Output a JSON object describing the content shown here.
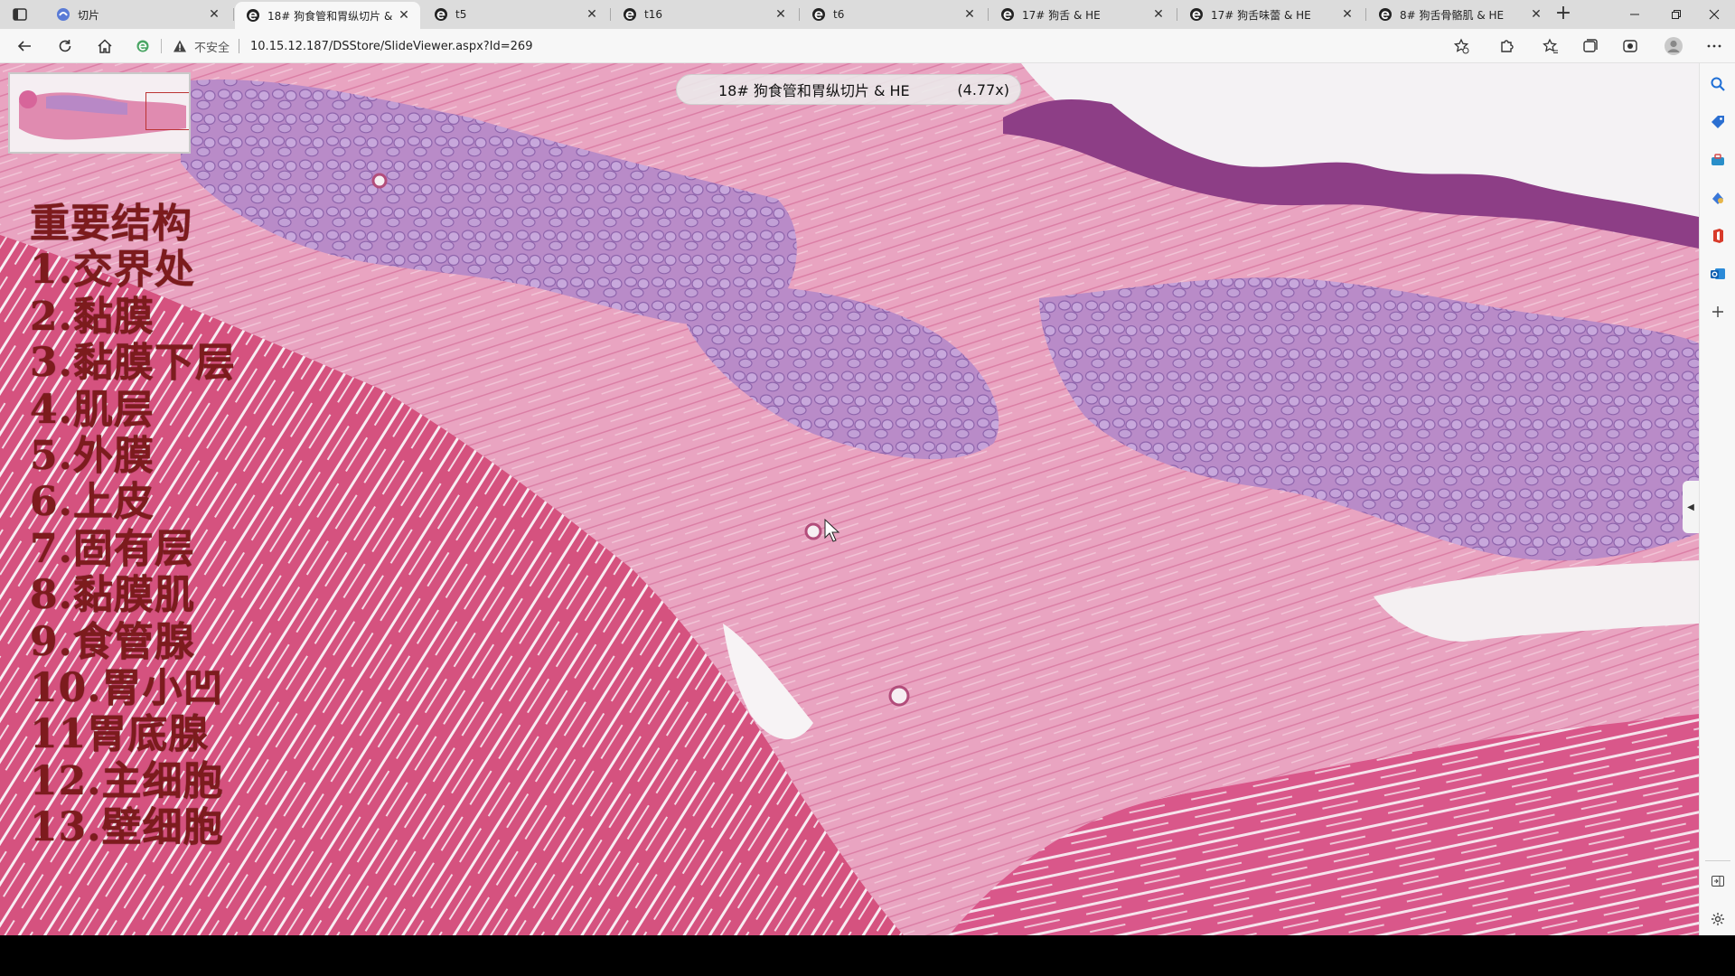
{
  "browser": {
    "tabs": [
      {
        "title": "切片",
        "active": false
      },
      {
        "title": "18# 狗食管和胃纵切片 & HE",
        "active": true
      },
      {
        "title": "t5",
        "active": false
      },
      {
        "title": "t16",
        "active": false
      },
      {
        "title": "t6",
        "active": false
      },
      {
        "title": "17# 狗舌 & HE",
        "active": false
      },
      {
        "title": "17# 狗舌味蕾 & HE",
        "active": false
      },
      {
        "title": "8# 狗舌骨骼肌 & HE",
        "active": false
      }
    ],
    "new_tab_label": "+",
    "address": {
      "security_label": "不安全",
      "url": "10.15.12.187/DSStore/SlideViewer.aspx?Id=269"
    }
  },
  "viewer": {
    "slide_title": "18# 狗食管和胃纵切片 & HE",
    "zoom": "(4.77x)",
    "annotation_lines": [
      "重要结构",
      "1.交界处",
      "2.黏膜",
      "3.黏膜下层",
      "4.肌层",
      "5.外膜",
      "6.上皮",
      "7.固有层",
      "8.黏膜肌",
      "9.食管腺",
      "10.胃小凹",
      "11胃底腺",
      "12.主细胞",
      "13.壁细胞"
    ]
  },
  "colors": {
    "annotation_text": "#7d1b1d",
    "tissue_pink": "#e58fb4",
    "gland_purple": "#a77fc4",
    "muscle_red": "#d24a78"
  },
  "icons": {
    "tab_favicon": "edge-e-icon",
    "sidebar": [
      "search-icon",
      "tag-icon",
      "toolbox-icon",
      "games-icon",
      "office-icon",
      "outlook-icon",
      "add-icon",
      "panel-icon",
      "settings-icon"
    ]
  }
}
